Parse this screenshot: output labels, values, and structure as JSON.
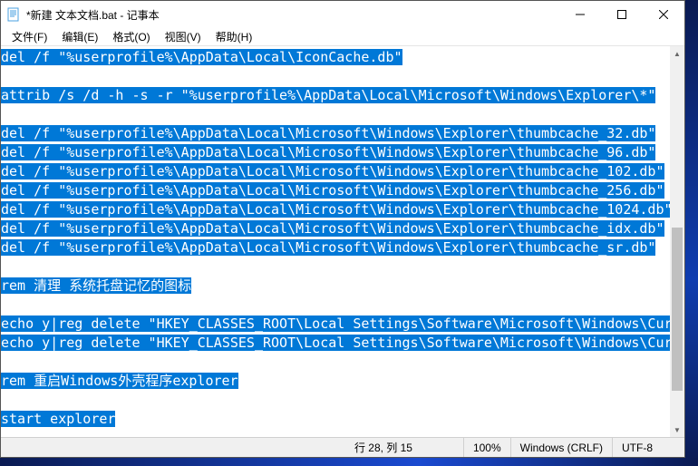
{
  "titlebar": {
    "title": "*新建 文本文档.bat - 记事本"
  },
  "menubar": {
    "items": [
      {
        "label": "文件(F)"
      },
      {
        "label": "编辑(E)"
      },
      {
        "label": "格式(O)"
      },
      {
        "label": "视图(V)"
      },
      {
        "label": "帮助(H)"
      }
    ]
  },
  "editor": {
    "lines": [
      "del /f \"%userprofile%\\AppData\\Local\\IconCache.db\"",
      "",
      "attrib /s /d -h -s -r \"%userprofile%\\AppData\\Local\\Microsoft\\Windows\\Explorer\\*\"",
      "",
      "del /f \"%userprofile%\\AppData\\Local\\Microsoft\\Windows\\Explorer\\thumbcache_32.db\"",
      "del /f \"%userprofile%\\AppData\\Local\\Microsoft\\Windows\\Explorer\\thumbcache_96.db\"",
      "del /f \"%userprofile%\\AppData\\Local\\Microsoft\\Windows\\Explorer\\thumbcache_102.db\"",
      "del /f \"%userprofile%\\AppData\\Local\\Microsoft\\Windows\\Explorer\\thumbcache_256.db\"",
      "del /f \"%userprofile%\\AppData\\Local\\Microsoft\\Windows\\Explorer\\thumbcache_1024.db\"",
      "del /f \"%userprofile%\\AppData\\Local\\Microsoft\\Windows\\Explorer\\thumbcache_idx.db\"",
      "del /f \"%userprofile%\\AppData\\Local\\Microsoft\\Windows\\Explorer\\thumbcache_sr.db\"",
      "",
      "rem 清理 系统托盘记忆的图标",
      "",
      "echo y|reg delete \"HKEY_CLASSES_ROOT\\Local Settings\\Software\\Microsoft\\Windows\\CurrentV",
      "echo y|reg delete \"HKEY_CLASSES_ROOT\\Local Settings\\Software\\Microsoft\\Windows\\CurrentV",
      "",
      "rem 重启Windows外壳程序explorer",
      "",
      "start explorer"
    ]
  },
  "statusbar": {
    "position": "行 28, 列 15",
    "zoom": "100%",
    "eol": "Windows (CRLF)",
    "encoding": "UTF-8"
  }
}
